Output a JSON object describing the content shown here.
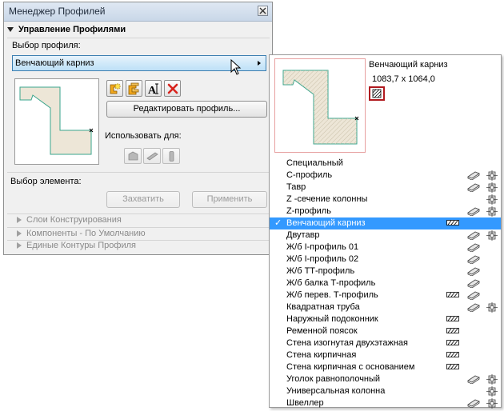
{
  "window": {
    "title": "Менеджер Профилей"
  },
  "panel": {
    "section_manage": "Управление Профилями",
    "select_profile_label": "Выбор профиля:",
    "selected_profile": "Венчающий карниз",
    "edit_button": "Редактировать профиль...",
    "use_for_label": "Использовать для:",
    "select_element_label": "Выбор элемента:",
    "capture_button": "Захватить",
    "apply_button": "Применить",
    "collapsed_sections": [
      "Слои Конструирования",
      "Компоненты - По Умолчанию",
      "Единые Контуры Профиля"
    ]
  },
  "popup": {
    "name": "Венчающий карниз",
    "size": "1083,7 x 1064,0",
    "items": [
      {
        "name": "Специальный",
        "slab": false,
        "beam": false,
        "col": false,
        "selected": false
      },
      {
        "name": "С-профиль",
        "slab": false,
        "beam": true,
        "col": true,
        "selected": false
      },
      {
        "name": "Тавр",
        "slab": false,
        "beam": true,
        "col": true,
        "selected": false
      },
      {
        "name": "Z -сечение колонны",
        "slab": false,
        "beam": false,
        "col": true,
        "selected": false
      },
      {
        "name": "Z-профиль",
        "slab": false,
        "beam": true,
        "col": true,
        "selected": false
      },
      {
        "name": "Венчающий карниз",
        "slab": true,
        "beam": false,
        "col": false,
        "selected": true
      },
      {
        "name": "Двутавр",
        "slab": false,
        "beam": true,
        "col": true,
        "selected": false
      },
      {
        "name": "Ж/б I-профиль 01",
        "slab": false,
        "beam": true,
        "col": false,
        "selected": false
      },
      {
        "name": "Ж/б I-профиль 02",
        "slab": false,
        "beam": true,
        "col": false,
        "selected": false
      },
      {
        "name": "Ж/б ТТ-профиль",
        "slab": false,
        "beam": true,
        "col": false,
        "selected": false
      },
      {
        "name": "Ж/б балка Т-профиль",
        "slab": false,
        "beam": true,
        "col": false,
        "selected": false
      },
      {
        "name": "Ж/б перев. Т-профиль",
        "slab": true,
        "beam": true,
        "col": false,
        "selected": false
      },
      {
        "name": "Квадратная труба",
        "slab": false,
        "beam": true,
        "col": true,
        "selected": false
      },
      {
        "name": "Наружный подоконник",
        "slab": true,
        "beam": false,
        "col": false,
        "selected": false
      },
      {
        "name": "Ременной поясок",
        "slab": true,
        "beam": false,
        "col": false,
        "selected": false
      },
      {
        "name": "Стена изогнутая двухэтажная",
        "slab": true,
        "beam": false,
        "col": false,
        "selected": false
      },
      {
        "name": "Стена кирпичная",
        "slab": true,
        "beam": false,
        "col": false,
        "selected": false
      },
      {
        "name": "Стена кирпичная с основанием",
        "slab": true,
        "beam": false,
        "col": false,
        "selected": false
      },
      {
        "name": "Уголок равнополочный",
        "slab": false,
        "beam": true,
        "col": true,
        "selected": false
      },
      {
        "name": "Универсальная колонна",
        "slab": false,
        "beam": false,
        "col": true,
        "selected": false
      },
      {
        "name": "Швеллер",
        "slab": false,
        "beam": true,
        "col": true,
        "selected": false
      }
    ]
  },
  "colors": {
    "selection": "#3399ff",
    "profile_fill": "#ede6d7",
    "profile_stroke": "#3aa58c",
    "delete_red": "#d8231d"
  }
}
